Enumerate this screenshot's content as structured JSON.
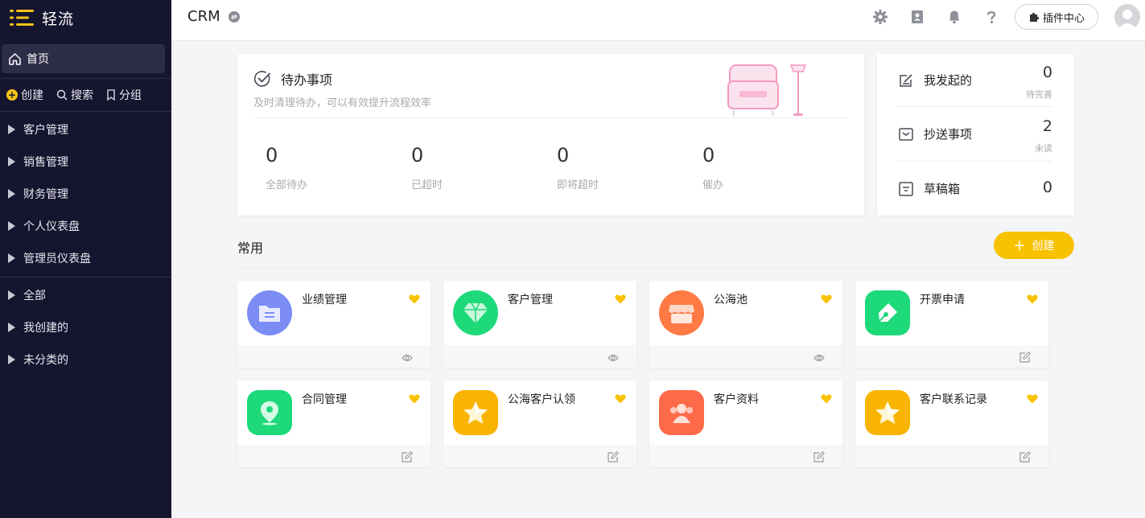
{
  "brand": {
    "name": "轻流"
  },
  "sidebar": {
    "home_label": "首页",
    "quick": [
      {
        "label": "创建",
        "icon": "plus-circle-icon"
      },
      {
        "label": "搜索",
        "icon": "search-icon"
      },
      {
        "label": "分组",
        "icon": "bookmark-icon"
      }
    ],
    "groups": [
      "客户管理",
      "销售管理",
      "财务管理",
      "个人仪表盘",
      "管理员仪表盘"
    ],
    "filters": [
      "全部",
      "我创建的",
      "未分类的"
    ]
  },
  "header": {
    "title": "CRM",
    "plugin_label": "插件中心"
  },
  "todo": {
    "title": "待办事项",
    "subtitle": "及时清理待办，可以有效提升流程效率",
    "stats": [
      {
        "value": "0",
        "label": "全部待办"
      },
      {
        "value": "0",
        "label": "已超时"
      },
      {
        "value": "0",
        "label": "即将超时"
      },
      {
        "value": "0",
        "label": "催办"
      }
    ]
  },
  "mine": {
    "rows": [
      {
        "label": "我发起的",
        "value": "0",
        "sub": "待完善"
      },
      {
        "label": "抄送事项",
        "value": "2",
        "sub": "未读"
      },
      {
        "label": "草稿箱",
        "value": "0",
        "sub": ""
      }
    ]
  },
  "common": {
    "title": "常用",
    "create_label": "创建",
    "apps": [
      {
        "name": "业绩管理",
        "icon": "folder-icon",
        "color": "#7b8cf5",
        "action": "eye-icon"
      },
      {
        "name": "客户管理",
        "icon": "diamond-icon",
        "color": "#1ed97a",
        "action": "eye-icon"
      },
      {
        "name": "公海池",
        "icon": "shop-icon",
        "color": "#ff7a45",
        "action": "eye-icon"
      },
      {
        "name": "开票申请",
        "icon": "pen-icon",
        "color": "#1ed97a",
        "action": "edit-icon"
      },
      {
        "name": "合同管理",
        "icon": "location-icon",
        "color": "#1ed97a",
        "action": "edit-icon"
      },
      {
        "name": "公海客户认领",
        "icon": "star-icon",
        "color": "#f8b400",
        "action": "edit-icon"
      },
      {
        "name": "客户资料",
        "icon": "users-icon",
        "color": "#ff6b4a",
        "action": "edit-icon"
      },
      {
        "name": "客户联系记录",
        "icon": "star-icon",
        "color": "#f8b400",
        "action": "edit-icon"
      }
    ]
  }
}
